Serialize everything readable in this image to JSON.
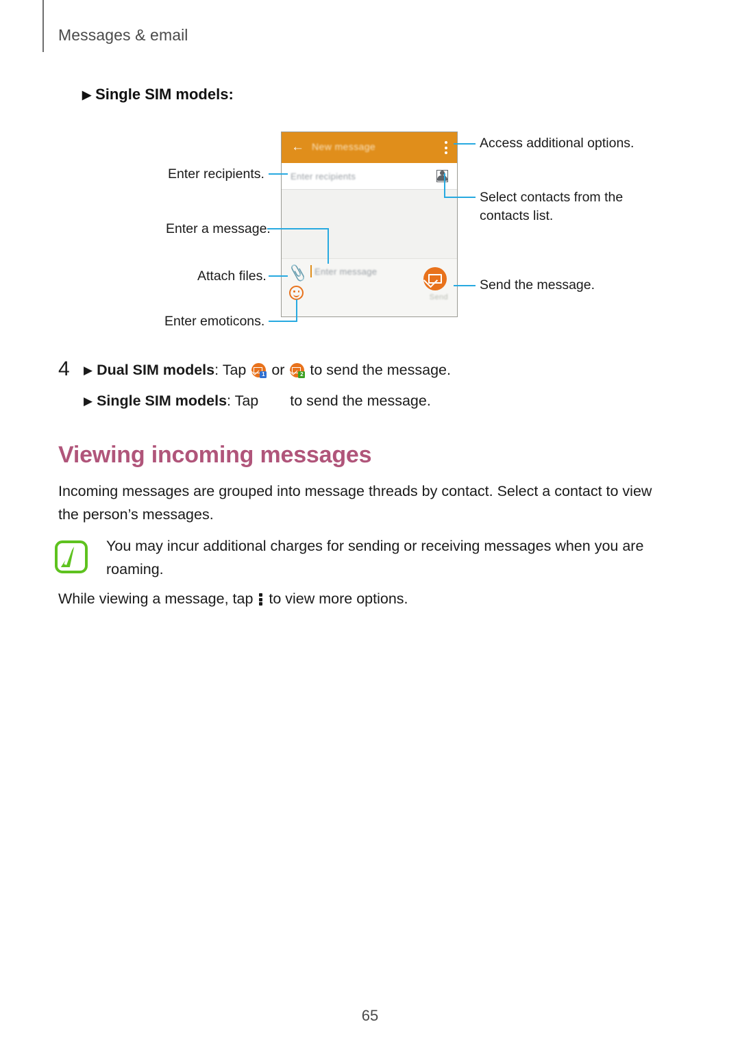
{
  "page": {
    "running_head": "Messages & email",
    "page_number": "65"
  },
  "subhead": {
    "bullet": "▶",
    "label": "Single SIM models:"
  },
  "figure": {
    "phone": {
      "appbar_title": "New message",
      "back_icon": "back-arrow-icon",
      "overflow_icon": "overflow-menu-icon",
      "recipients_placeholder": "Enter recipients",
      "contacts_icon": "contacts-picker-icon",
      "attach_icon": "paperclip-icon",
      "message_placeholder": "Enter message",
      "emoticon_icon": "smiley-icon",
      "send_icon": "send-message-icon",
      "send_label": "Send"
    },
    "callouts": {
      "left": [
        {
          "id": "enter-recipients",
          "text": "Enter recipients."
        },
        {
          "id": "enter-a-message",
          "text": "Enter a message."
        },
        {
          "id": "attach-files",
          "text": "Attach files."
        },
        {
          "id": "enter-emoticons",
          "text": "Enter emoticons."
        }
      ],
      "right": [
        {
          "id": "access-additional-options",
          "text": "Access additional options."
        },
        {
          "id": "select-contacts",
          "line1": "Select contacts from the",
          "line2": "contacts list."
        },
        {
          "id": "send-the-message",
          "text": "Send the message."
        }
      ]
    }
  },
  "step4": {
    "number": "4",
    "bullet": "▶",
    "dual": {
      "label": "Dual SIM models",
      "colon": ":",
      "tap": " Tap ",
      "or": " or ",
      "tail": " to send the message.",
      "sim1_badge": "1",
      "sim2_badge": "2"
    },
    "single": {
      "label": "Single SIM models",
      "colon": ":",
      "tap": " Tap ",
      "tail": " to send the message."
    }
  },
  "section": {
    "heading": "Viewing incoming messages",
    "intro": "Incoming messages are grouped into message threads by contact. Select a contact to view the person’s messages."
  },
  "note": {
    "icon": "note-pencil-icon",
    "text": "You may incur additional charges for sending or receiving messages when you are roaming."
  },
  "more_options": {
    "prefix": "While viewing a message, tap ",
    "icon": "overflow-menu-icon",
    "suffix": " to view more options."
  },
  "colors": {
    "accent_orange": "#e08e1b",
    "send_orange": "#e8721c",
    "lead_blue": "#27a9e0",
    "heading_rose": "#b0557a",
    "note_green": "#5ec21f"
  }
}
